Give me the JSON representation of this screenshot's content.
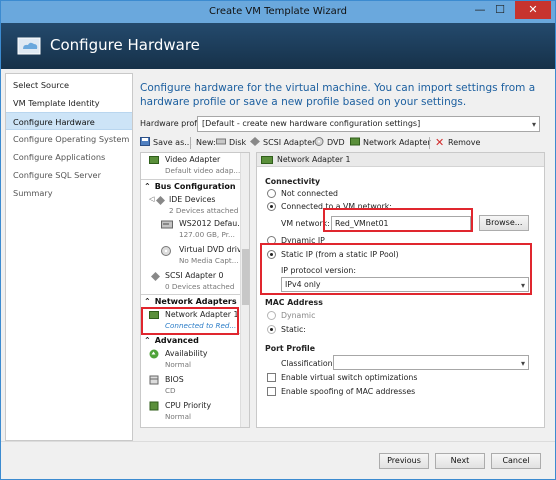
{
  "window": {
    "title": "Create VM Template Wizard",
    "close_glyph": "✕",
    "min_glyph": "—",
    "max_glyph": "☐"
  },
  "header": {
    "title": "Configure Hardware"
  },
  "nav": {
    "items": [
      {
        "label": "Select Source"
      },
      {
        "label": "VM Template Identity"
      },
      {
        "label": "Configure Hardware"
      },
      {
        "label": "Configure Operating System"
      },
      {
        "label": "Configure Applications"
      },
      {
        "label": "Configure SQL Server"
      },
      {
        "label": "Summary"
      }
    ]
  },
  "intro": "Configure hardware for the virtual machine. You can import settings from a hardware profile or save a new profile based on your settings.",
  "hardware_profile": {
    "label": "Hardware profile:",
    "value": "[Default - create new hardware configuration settings]"
  },
  "toolbar": {
    "save_as": "Save as...",
    "new": "New:",
    "disk": "Disk",
    "scsi": "SCSI Adapter",
    "dvd": "DVD",
    "network": "Network Adapter",
    "remove": "Remove"
  },
  "hw_list": {
    "video": {
      "title": "Video Adapter",
      "sub": "Default video adap..."
    },
    "bus_header": "Bus Configuration",
    "ide": {
      "title": "IDE Devices",
      "sub": "2 Devices attached"
    },
    "ws2012": {
      "title": "WS2012 Defau...",
      "sub": "127.00 GB, Pr..."
    },
    "dvd": {
      "title": "Virtual DVD drive",
      "sub": "No Media Capt..."
    },
    "scsi": {
      "title": "SCSI Adapter 0",
      "sub": "0 Devices attached"
    },
    "net_header": "Network Adapters",
    "net1": {
      "title": "Network Adapter 1",
      "sub": "Connected to Red..."
    },
    "adv_header": "Advanced",
    "availability": {
      "title": "Availability",
      "sub": "Normal"
    },
    "bios": {
      "title": "BIOS",
      "sub": "CD"
    },
    "cpu": {
      "title": "CPU Priority",
      "sub": "Normal"
    }
  },
  "details": {
    "header": "Network Adapter 1",
    "connectivity": "Connectivity",
    "not_connected": "Not connected",
    "connected_vm": "Connected to a VM network:",
    "vm_network_label": "VM network:",
    "vm_network_value": "Red_VMnet01",
    "browse": "Browse...",
    "dynamic_ip": "Dynamic IP",
    "static_ip": "Static IP (from a static IP Pool)",
    "ip_protocol_label": "IP protocol version:",
    "ip_protocol_value": "IPv4 only",
    "mac_address": "MAC Address",
    "dynamic": "Dynamic",
    "static": "Static:",
    "port_profile": "Port Profile",
    "classification": "Classification:",
    "classification_value": "",
    "enable_vswitch": "Enable virtual switch optimizations",
    "enable_spoofing": "Enable spoofing of MAC addresses"
  },
  "buttons": {
    "previous": "Previous",
    "next": "Next",
    "cancel": "Cancel"
  }
}
